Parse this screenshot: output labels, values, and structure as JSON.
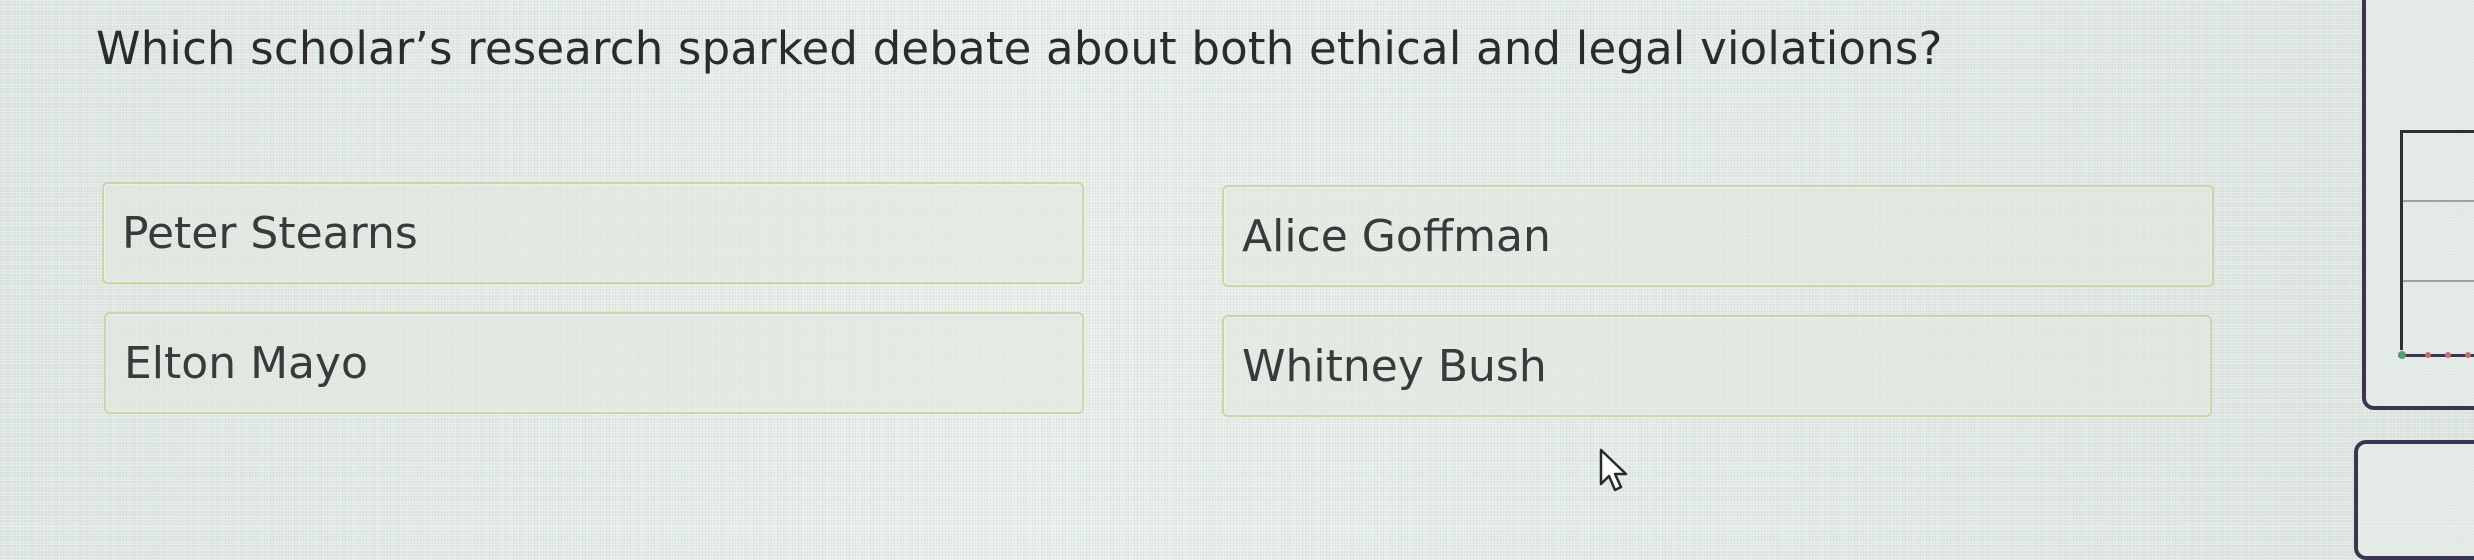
{
  "question": {
    "text": "Which scholar’s research sparked debate about both ethical and legal violations?"
  },
  "options": [
    {
      "label": "Peter Stearns"
    },
    {
      "label": "Alice Goffman"
    },
    {
      "label": "Elton Mayo"
    },
    {
      "label": "Whitney Bush"
    }
  ],
  "icons": {
    "cursor": "pointer-cursor-icon"
  },
  "colors": {
    "option_border": "#cdd4a8",
    "side_frame": "#3b3550",
    "text": "#2b2b2b"
  }
}
